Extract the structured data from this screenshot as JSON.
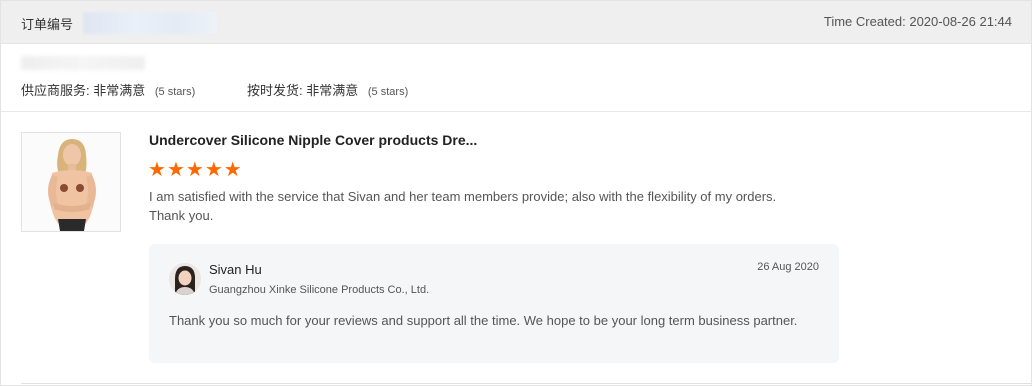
{
  "header": {
    "order_label": "订单编号",
    "time_created": "Time Created: 2020-08-26 21:44"
  },
  "ratings": [
    {
      "label": "供应商服务:",
      "value": "非常满意",
      "stars": "(5 stars)"
    },
    {
      "label": "按时发货:",
      "value": "非常满意",
      "stars": "(5 stars)"
    }
  ],
  "review": {
    "product_title": "Undercover Silicone Nipple Cover products Dre...",
    "rating_stars": 5,
    "star_color": "#ff6a00",
    "comment": "I am satisfied with the service that Sivan and her team members provide; also with the flexibility of my orders. Thank you."
  },
  "reply": {
    "name": "Sivan Hu",
    "company": "Guangzhou Xinke Silicone Products Co., Ltd.",
    "date": "26 Aug 2020",
    "text": "Thank you so much for your reviews and support all the time. We hope to be your long term business partner."
  }
}
